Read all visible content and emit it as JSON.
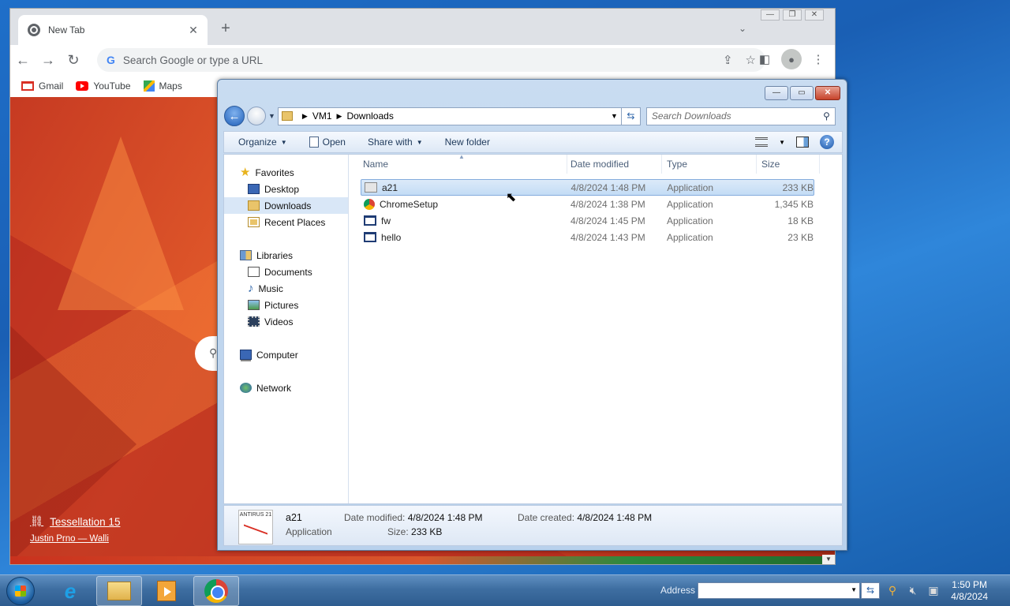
{
  "chrome": {
    "tab_title": "New Tab",
    "tab_close": "✕",
    "new_tab": "+",
    "omnibox_placeholder": "Search Google or type a URL",
    "google_glyph": "G",
    "bookmarks": [
      {
        "label": "Gmail",
        "icon": "gmail-icon"
      },
      {
        "label": "YouTube",
        "icon": "youtube-icon"
      },
      {
        "label": "Maps",
        "icon": "maps-icon"
      }
    ],
    "credit_title": "Tessellation 15",
    "credit_author": "Justin Prno — Walli"
  },
  "explorer": {
    "breadcrumb": [
      "VM1",
      "Downloads"
    ],
    "search_placeholder": "Search Downloads",
    "commands": {
      "organize": "Organize",
      "open": "Open",
      "share_with": "Share with",
      "new_folder": "New folder"
    },
    "nav": {
      "favorites": "Favorites",
      "desktop": "Desktop",
      "downloads": "Downloads",
      "recent_places": "Recent Places",
      "libraries": "Libraries",
      "documents": "Documents",
      "music": "Music",
      "pictures": "Pictures",
      "videos": "Videos",
      "computer": "Computer",
      "network": "Network"
    },
    "columns": {
      "name": "Name",
      "date": "Date modified",
      "type": "Type",
      "size": "Size"
    },
    "files": [
      {
        "name": "a21",
        "date": "4/8/2024 1:48 PM",
        "type": "Application",
        "size": "233 KB",
        "icon": "a21-app-icon",
        "selected": true
      },
      {
        "name": "ChromeSetup",
        "date": "4/8/2024 1:38 PM",
        "type": "Application",
        "size": "1,345 KB",
        "icon": "chrome-setup-icon",
        "selected": false
      },
      {
        "name": "fw",
        "date": "4/8/2024 1:45 PM",
        "type": "Application",
        "size": "18 KB",
        "icon": "application-icon",
        "selected": false
      },
      {
        "name": "hello",
        "date": "4/8/2024 1:43 PM",
        "type": "Application",
        "size": "23 KB",
        "icon": "application-icon",
        "selected": false
      }
    ],
    "details": {
      "thumb_text": "ANTIRUS 21",
      "name": "a21",
      "type": "Application",
      "modified_label": "Date modified:",
      "modified_value": "4/8/2024 1:48 PM",
      "size_label": "Size:",
      "size_value": "233 KB",
      "created_label": "Date created:",
      "created_value": "4/8/2024 1:48 PM"
    }
  },
  "taskbar": {
    "address_label": "Address",
    "clock_time": "1:50 PM",
    "clock_date": "4/8/2024"
  }
}
